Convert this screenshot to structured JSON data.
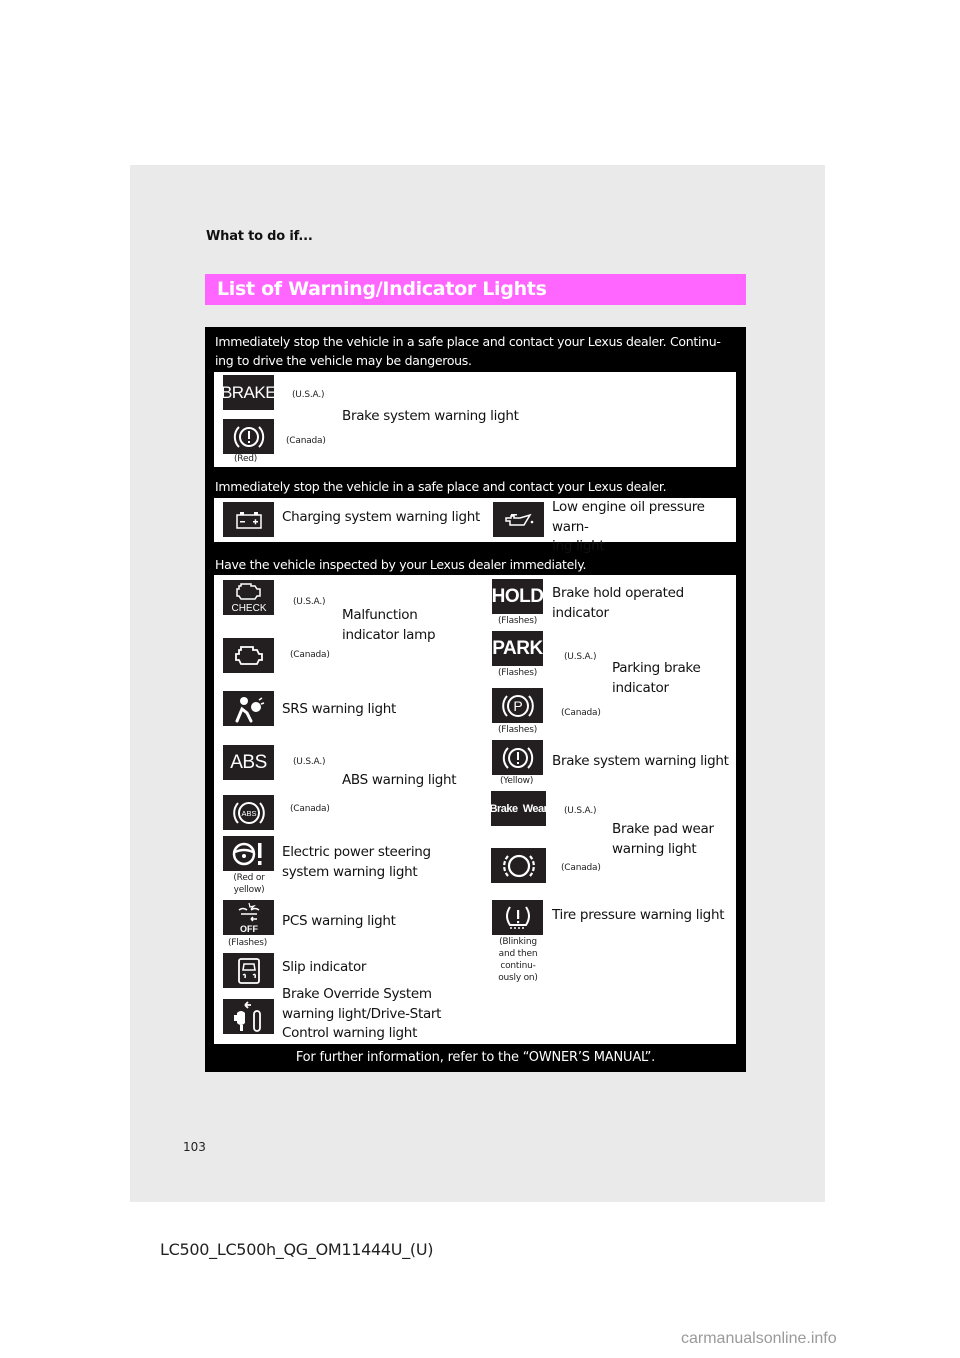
{
  "page": {
    "section_header": "What to do if...",
    "title": "List of Warning/Indicator Lights",
    "page_number": "103",
    "doc_id": "LC500_LC500h_QG_OM11444U_(U)",
    "watermark": "carmanualsonline.info",
    "accent_color": "#ff66ff"
  },
  "groups": [
    {
      "heading": "Immediately stop the vehicle in a safe place and contact your Lexus dealer. Continu-ing to drive the vehicle may be dangerous.",
      "heading_line1": "Immediately stop the vehicle in a safe place and contact your Lexus dealer. Continu-",
      "heading_line2": "ing to drive the vehicle may be dangerous.",
      "items": [
        {
          "label": "Brake system warning light",
          "variants": [
            {
              "icon": "brake-text-icon",
              "icon_text": "BRAKE",
              "region": "(U.S.A.)"
            },
            {
              "icon": "brake-warning-circle-icon",
              "region": "(Canada)",
              "note": "(Red)"
            }
          ]
        }
      ]
    },
    {
      "heading": "Immediately stop the vehicle in a safe place and contact your Lexus dealer.",
      "items": [
        {
          "label": "Charging system warning light",
          "icon": "battery-icon"
        },
        {
          "label_line1": "Low engine oil pressure warn-",
          "label_line2": "ing light",
          "icon": "oil-can-icon"
        }
      ]
    },
    {
      "heading": "Have the vehicle inspected by your Lexus dealer immediately.",
      "left_items": [
        {
          "label_line1": "Malfunction",
          "label_line2": "indicator lamp",
          "variants": [
            {
              "icon": "engine-check-icon",
              "icon_text": "CHECK",
              "region": "(U.S.A.)"
            },
            {
              "icon": "engine-icon",
              "region": "(Canada)"
            }
          ]
        },
        {
          "label": "SRS warning light",
          "icon": "airbag-icon"
        },
        {
          "label": "ABS warning light",
          "variants": [
            {
              "icon": "abs-text-icon",
              "icon_text": "ABS",
              "region": "(U.S.A.)"
            },
            {
              "icon": "abs-circle-icon",
              "icon_text": "ABS",
              "region": "(Canada)"
            }
          ]
        },
        {
          "label_line1": "Electric power steering",
          "label_line2": "system warning light",
          "icon": "steering-warning-icon",
          "note_line1": "(Red or",
          "note_line2": "yellow)"
        },
        {
          "label": "PCS warning light",
          "icon": "pcs-off-icon",
          "icon_text": "OFF",
          "note": "(Flashes)"
        },
        {
          "label": "Slip indicator",
          "icon": "slip-icon"
        },
        {
          "label_line1": "Brake Override System",
          "label_line2": "warning light/Drive-Start",
          "label_line3": "Control warning light",
          "icon": "brake-override-icon"
        }
      ],
      "right_items": [
        {
          "label": "Brake hold operated indicator",
          "icon": "hold-icon",
          "icon_text": "HOLD",
          "note": "(Flashes)"
        },
        {
          "label_line1": "Parking brake",
          "label_line2": "indicator",
          "variants": [
            {
              "icon": "park-text-icon",
              "icon_text": "PARK",
              "region": "(U.S.A.)",
              "note": "(Flashes)"
            },
            {
              "icon": "parking-brake-circle-icon",
              "icon_text": "P",
              "region": "(Canada)",
              "note": "(Flashes)"
            }
          ]
        },
        {
          "label": "Brake system warning light",
          "icon": "brake-warning-circle-icon",
          "note": "(Yellow)"
        },
        {
          "label_line1": "Brake pad wear",
          "label_line2": "warning light",
          "variants": [
            {
              "icon": "brake-wear-text-icon",
              "icon_text": "Brake  Wear",
              "region": "(U.S.A.)"
            },
            {
              "icon": "brake-pad-circle-icon",
              "region": "(Canada)"
            }
          ]
        },
        {
          "label": "Tire pressure warning light",
          "icon": "tire-pressure-icon",
          "note_line1": "(Blinking",
          "note_line2": "and then",
          "note_line3": "continu-",
          "note_line4": "ously on)"
        }
      ]
    }
  ],
  "footer_note": "For further information, refer to the “OWNER’S MANUAL”."
}
